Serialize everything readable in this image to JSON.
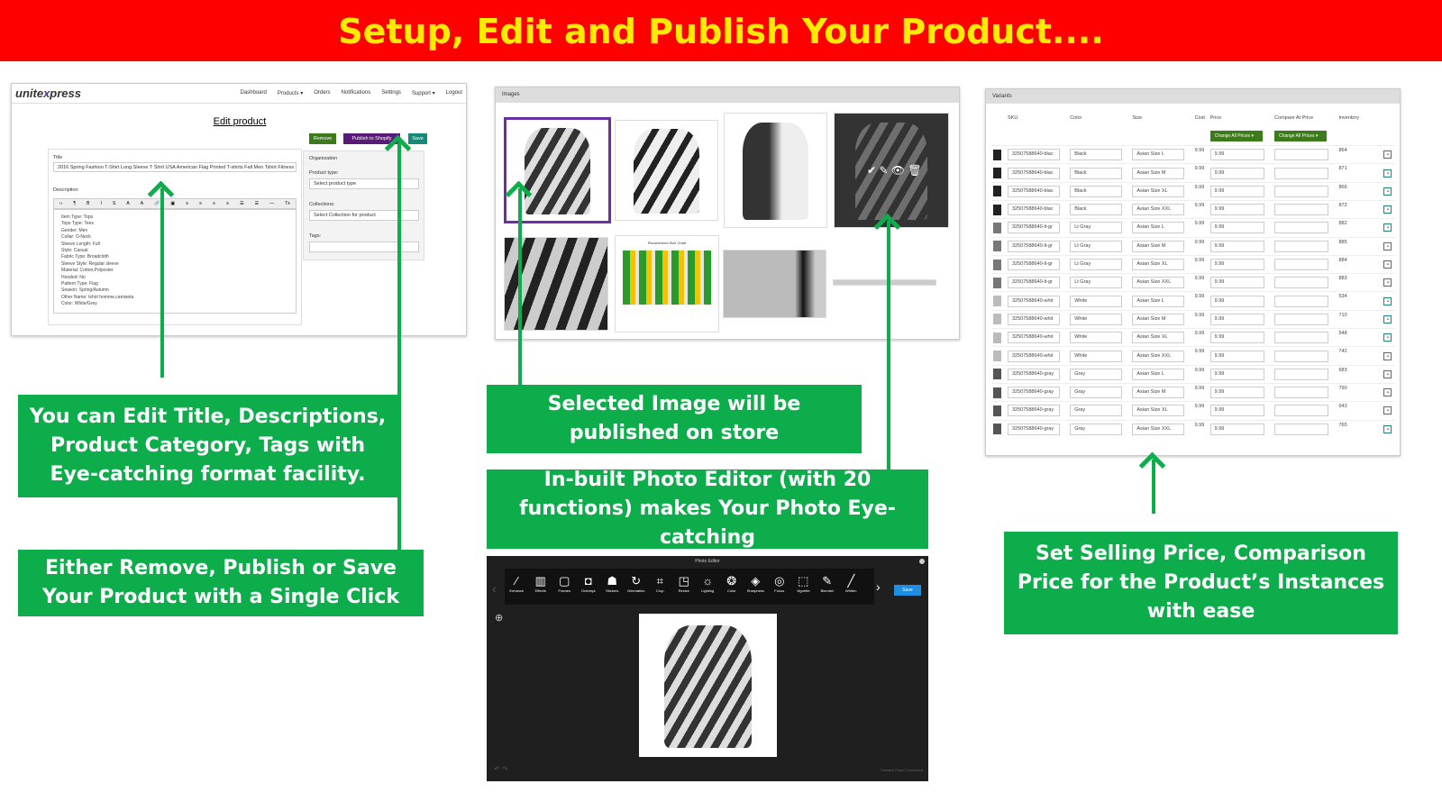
{
  "banner": {
    "title": "Setup, Edit and Publish Your Product...."
  },
  "edit_panel": {
    "logo": "unitexpress",
    "nav": [
      "Dashboard",
      "Products ▾",
      "Orders",
      "Notifications",
      "Settings",
      "Support ▾",
      "Logout"
    ],
    "page_title": "Edit product",
    "buttons": {
      "remove": "Remove",
      "publish": "Publish to Shopify",
      "save": "Save"
    },
    "title_label": "Title",
    "title_value": "2016 Spring Fashion T-Shirt Long Sleeve T Shirt USA American Flag Printed T-shirts Fall Men Tshirt Fitness C",
    "description_label": "Description",
    "toolbar": [
      "‹›",
      "¶",
      "B",
      "I",
      "S",
      "A",
      "A",
      "🔗",
      "▣",
      "≡",
      "≡",
      "≡",
      "≡",
      "☰",
      "☰",
      "—",
      "Tx"
    ],
    "description_lines": [
      "Item Type: Tops",
      "Tops Type: Tees",
      "Gender: Men",
      "Collar: O-Neck",
      "Sleeve Length: Full",
      "Style: Casual",
      "Fabric Type: Broadcloth",
      "Sleeve Style: Regular sleeve",
      "Material: Cotton,Polyester",
      "Hooded: No",
      "Pattern Type: Flag",
      "Season: Spring/Autumn",
      "Other Name: tshirt homme,camiseta",
      "Color: White/Grey"
    ],
    "organization_label": "Organization",
    "product_type_label": "Product type:",
    "product_type_value": "Select product type",
    "collections_label": "Collections:",
    "collections_value": "Select Collection for product",
    "tags_label": "Tags:"
  },
  "images_panel": {
    "header": "Images",
    "size_chart_title": "Recommend Size Chart",
    "selected_index": 0
  },
  "variants_panel": {
    "header": "Variants",
    "columns": [
      "SKU",
      "Color",
      "Size",
      "Cost",
      "Price",
      "Compare At Price",
      "Inventory"
    ],
    "change_all_prices": "Change All Prices ▾",
    "rows": [
      {
        "sku": "32507588640-blac",
        "color": "Black",
        "size": "Asian Size L",
        "cost": "9.99",
        "price": "9.99",
        "inventory": "864"
      },
      {
        "sku": "32507588640-blac",
        "color": "Black",
        "size": "Asian Size M",
        "cost": "9.99",
        "price": "9.99",
        "inventory": "871"
      },
      {
        "sku": "32507588640-blac",
        "color": "Black",
        "size": "Asian Size XL",
        "cost": "9.99",
        "price": "9.99",
        "inventory": "866"
      },
      {
        "sku": "32507588640-blac",
        "color": "Black",
        "size": "Asian Size XXL",
        "cost": "9.99",
        "price": "9.99",
        "inventory": "872"
      },
      {
        "sku": "32507588640-lt-gr",
        "color": "Lt Gray",
        "size": "Asian Size L",
        "cost": "9.99",
        "price": "9.99",
        "inventory": "882"
      },
      {
        "sku": "32507588640-lt-gr",
        "color": "Lt Gray",
        "size": "Asian Size M",
        "cost": "9.99",
        "price": "9.99",
        "inventory": "885"
      },
      {
        "sku": "32507588640-lt-gr",
        "color": "Lt Gray",
        "size": "Asian Size XL",
        "cost": "9.99",
        "price": "9.99",
        "inventory": "884"
      },
      {
        "sku": "32507588640-lt-gr",
        "color": "Lt Gray",
        "size": "Asian Size XXL",
        "cost": "9.99",
        "price": "9.99",
        "inventory": "883"
      },
      {
        "sku": "32507588640-whit",
        "color": "White",
        "size": "Asian Size L",
        "cost": "9.99",
        "price": "9.99",
        "inventory": "534"
      },
      {
        "sku": "32507588640-whit",
        "color": "White",
        "size": "Asian Size M",
        "cost": "9.99",
        "price": "9.99",
        "inventory": "710"
      },
      {
        "sku": "32507588640-whit",
        "color": "White",
        "size": "Asian Size XL",
        "cost": "9.99",
        "price": "9.99",
        "inventory": "548"
      },
      {
        "sku": "32507588640-whit",
        "color": "White",
        "size": "Asian Size XXL",
        "cost": "9.99",
        "price": "9.99",
        "inventory": "742"
      },
      {
        "sku": "32507588640-gray",
        "color": "Gray",
        "size": "Asian Size L",
        "cost": "9.99",
        "price": "9.99",
        "inventory": "683"
      },
      {
        "sku": "32507588640-gray",
        "color": "Gray",
        "size": "Asian Size M",
        "cost": "9.99",
        "price": "9.99",
        "inventory": "790"
      },
      {
        "sku": "32507588640-gray",
        "color": "Gray",
        "size": "Asian Size XL",
        "cost": "9.99",
        "price": "9.99",
        "inventory": "643"
      },
      {
        "sku": "32507588640-gray",
        "color": "Gray",
        "size": "Asian Size XXL",
        "cost": "9.99",
        "price": "9.99",
        "inventory": "765"
      }
    ]
  },
  "photo_editor": {
    "title": "Photo Editor",
    "tools": [
      [
        "Enhance",
        "⁄"
      ],
      [
        "Effects",
        "▥"
      ],
      [
        "Frames",
        "▢"
      ],
      [
        "Overlays",
        "◘"
      ],
      [
        "Stickers",
        "☗"
      ],
      [
        "Orientation",
        "↻"
      ],
      [
        "Crop",
        "⌗"
      ],
      [
        "Resize",
        "◳"
      ],
      [
        "Lighting",
        "☼"
      ],
      [
        "Color",
        "❂"
      ],
      [
        "Sharpness",
        "◈"
      ],
      [
        "Focus",
        "◎"
      ],
      [
        "Vignette",
        "⬚"
      ],
      [
        "Blemish",
        "✎"
      ],
      [
        "Whiten",
        "╱"
      ]
    ],
    "save": "Save",
    "status": "Creative Cloud Connected"
  },
  "callouts": {
    "edit": "You can Edit Title,  Descriptions, Product Category, Tags with Eye-catching format facility.",
    "publish": "Either Remove, Publish or Save Your Product with a Single Click",
    "selected": "Selected Image will be published on store",
    "editor": "In-built Photo Editor (with 20 functions) makes Your Photo Eye-catching",
    "price": "Set Selling Price, Comparison Price for the Product’s Instances with ease"
  },
  "colors": {
    "banner_bg": "#ff0000",
    "banner_text": "#ffeb00",
    "callout_green": "#0ead4b",
    "publish_purple": "#5a1a78",
    "remove_green": "#3d7a1c",
    "save_teal": "#138a7a"
  }
}
